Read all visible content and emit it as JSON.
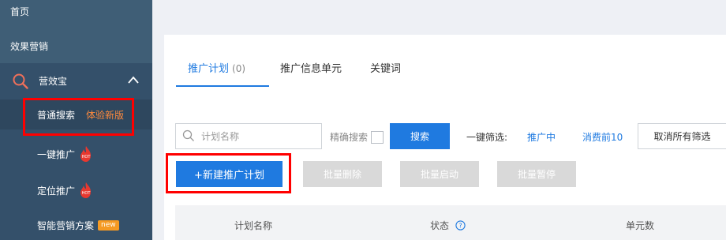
{
  "sidebar": {
    "home": "首页",
    "effect_marketing": "效果营销",
    "group": {
      "label": "营效宝",
      "items": [
        {
          "label": "普通搜索",
          "badge": "体验新版"
        },
        {
          "label": "一键推广",
          "badge_icon": "hot-icon"
        },
        {
          "label": "定位推广",
          "badge_icon": "hot-icon"
        },
        {
          "label": "智能营销方案",
          "badge": "new"
        }
      ]
    }
  },
  "tabs": [
    {
      "label": "推广计划",
      "count": "(0)"
    },
    {
      "label": "推广信息单元"
    },
    {
      "label": "关键词"
    }
  ],
  "filter": {
    "search_placeholder": "计划名称",
    "exact_label": "精确搜索",
    "search_button": "搜索",
    "quick_filter_label": "一键筛选:",
    "quick_filters": [
      "推广中",
      "消费前10"
    ],
    "clear_button": "取消所有筛选"
  },
  "actions": {
    "new_plan": "+新建推广计划",
    "batch_delete": "批量删除",
    "batch_start": "批量启动",
    "batch_pause": "批量暂停"
  },
  "table": {
    "columns": [
      "计划名称",
      "状态",
      "单元数"
    ]
  },
  "colors": {
    "sidebar": "#3f5e76",
    "accent": "#1f7ae0",
    "highlight": "#ff0000",
    "orange": "#ff8a3d"
  }
}
